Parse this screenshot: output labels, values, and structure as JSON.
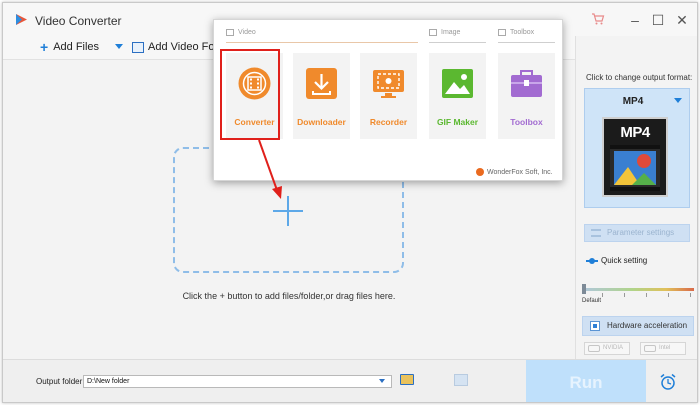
{
  "app": {
    "title": "Video Converter",
    "logo_icon": "wonderfox-logo-icon",
    "window_controls": [
      "cart-icon",
      "minimize-icon",
      "maximize-icon",
      "close-icon"
    ]
  },
  "toolbar": {
    "add_files_label": "Add Files",
    "add_video_folder_label": "Add Video Folder"
  },
  "dropzone": {
    "hint": "Click the + button to add files/folder,or drag files here."
  },
  "launcher": {
    "categories": {
      "video": "Video",
      "image": "Image",
      "toolbox": "Toolbox"
    },
    "tiles": [
      {
        "label": "Converter",
        "icon": "film-reel-icon",
        "color": "#f08a2c"
      },
      {
        "label": "Downloader",
        "icon": "download-icon",
        "color": "#f08a2c"
      },
      {
        "label": "Recorder",
        "icon": "screen-record-icon",
        "color": "#f08a2c"
      },
      {
        "label": "GIF Maker",
        "icon": "image-landscape-icon",
        "color": "#5bb830"
      },
      {
        "label": "Toolbox",
        "icon": "toolbox-icon",
        "color": "#a26bd1"
      }
    ],
    "brand": "WonderFox Soft, Inc.",
    "highlight_color": "#e0201b"
  },
  "output_panel": {
    "change_format_label": "Click to change output format:",
    "format": "MP4",
    "format_icon_text": "MP4",
    "parameter_settings_label": "Parameter settings",
    "quick_setting_label": "Quick setting",
    "default_label": "Default",
    "hardware_acceleration_label": "Hardware acceleration",
    "hardware_acceleration_checked": true,
    "gpu_options": [
      "NVIDIA",
      "Intel"
    ]
  },
  "bottom": {
    "output_folder_label": "Output folder:",
    "output_folder_value": "D:\\New folder",
    "run_label": "Run"
  },
  "colors": {
    "accent": "#1f7fd8",
    "run_button": "#bfe0fb",
    "dropzone_border": "#8fbde8"
  }
}
